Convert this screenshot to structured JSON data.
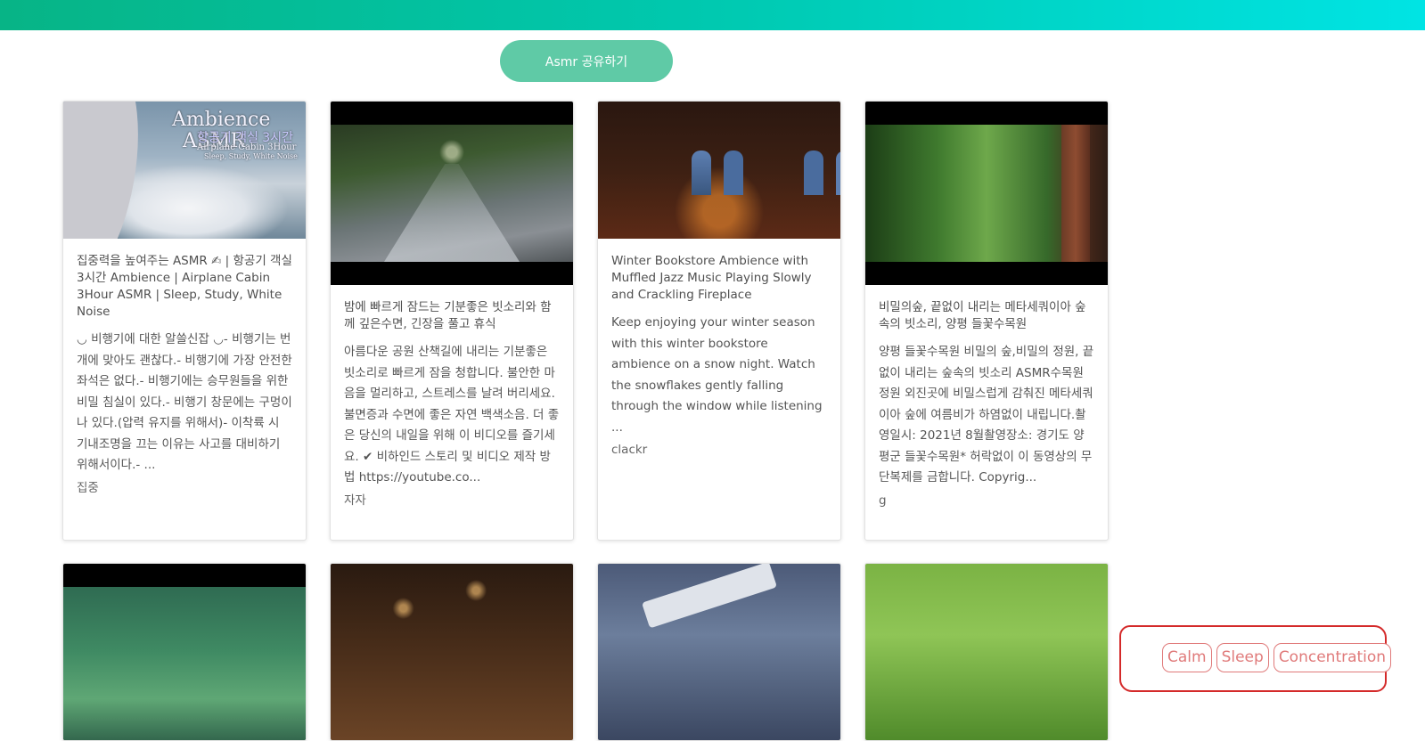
{
  "header": {
    "share_button": "Asmr 공유하기"
  },
  "cards": [
    {
      "title": "집중력을 높여주는 ASMR ✍ | 항공기 객실 3시간 Ambience | Airplane Cabin 3Hour ASMR | Sleep, Study, White Noise",
      "description": "◡ 비행기에 대한 알쓸신잡 ◡- 비행기는 번개에 맞아도 괜찮다.- 비행기에 가장 안전한 좌석은 없다.- 비행기에는 승무원들을 위한 비밀 침실이 있다.- 비행기 창문에는 구멍이 나 있다.(압력 유지를 위해서)- 이착륙 시 기내조명을 끄는 이유는 사고를 대비하기 위해서이다.- ...",
      "tag": "집중",
      "overlay": {
        "line1": "Ambience",
        "line2": "ASMR",
        "line3": "항공기 객실 3시간",
        "line4": "Airplane Cabin 3Hour",
        "line5": "Sleep, Study, White Noise"
      }
    },
    {
      "title": "밤에 빠르게 잠드는 기분좋은 빗소리와 함께 깊은수면, 긴장을 풀고 휴식",
      "description": "아름다운 공원 산책길에 내리는 기분좋은 빗소리로 빠르게 잠을 청합니다. 불안한 마음을 멀리하고, 스트레스를 날려 버리세요.불면증과 수면에 좋은 자연 백색소음. 더 좋은 당신의 내일을 위해 이 비디오를 즐기세요. ✔ 비하인드 스토리 및 비디오 제작 방법 https://youtube.co...",
      "tag": "자자"
    },
    {
      "title": "Winter Bookstore Ambience with Muffled Jazz Music Playing Slowly and Crackling Fireplace",
      "description": "Keep enjoying your winter season with this winter bookstore ambience on a snow night. Watch the snowflakes gently falling through the window while listening ...",
      "tag": "clackr"
    },
    {
      "title": "비밀의숲, 끝없이 내리는 메타세쿼이아 숲속의 빗소리, 양평 들꽃수목원",
      "description": "양평 들꽃수목원 비밀의 숲,비밀의 정원, 끝없이 내리는 숲속의 빗소리 ASMR수목원 정원 외진곳에 비밀스럽게 감춰진 메타세쿼이아 숲에 여름비가 하염없이 내립니다.촬영일시: 2021년 8월촬영장소: 경기도 양평군 들꽃수목원* 허락없이 이 동영상의 무단복제를 금합니다. Copyrig...",
      "tag": "g"
    }
  ],
  "tags": [
    "Calm",
    "Sleep",
    "Concentration"
  ],
  "colors": {
    "accent": "#5fcaa6",
    "tag": "#e07a7a",
    "highlight": "#d42a2a"
  }
}
